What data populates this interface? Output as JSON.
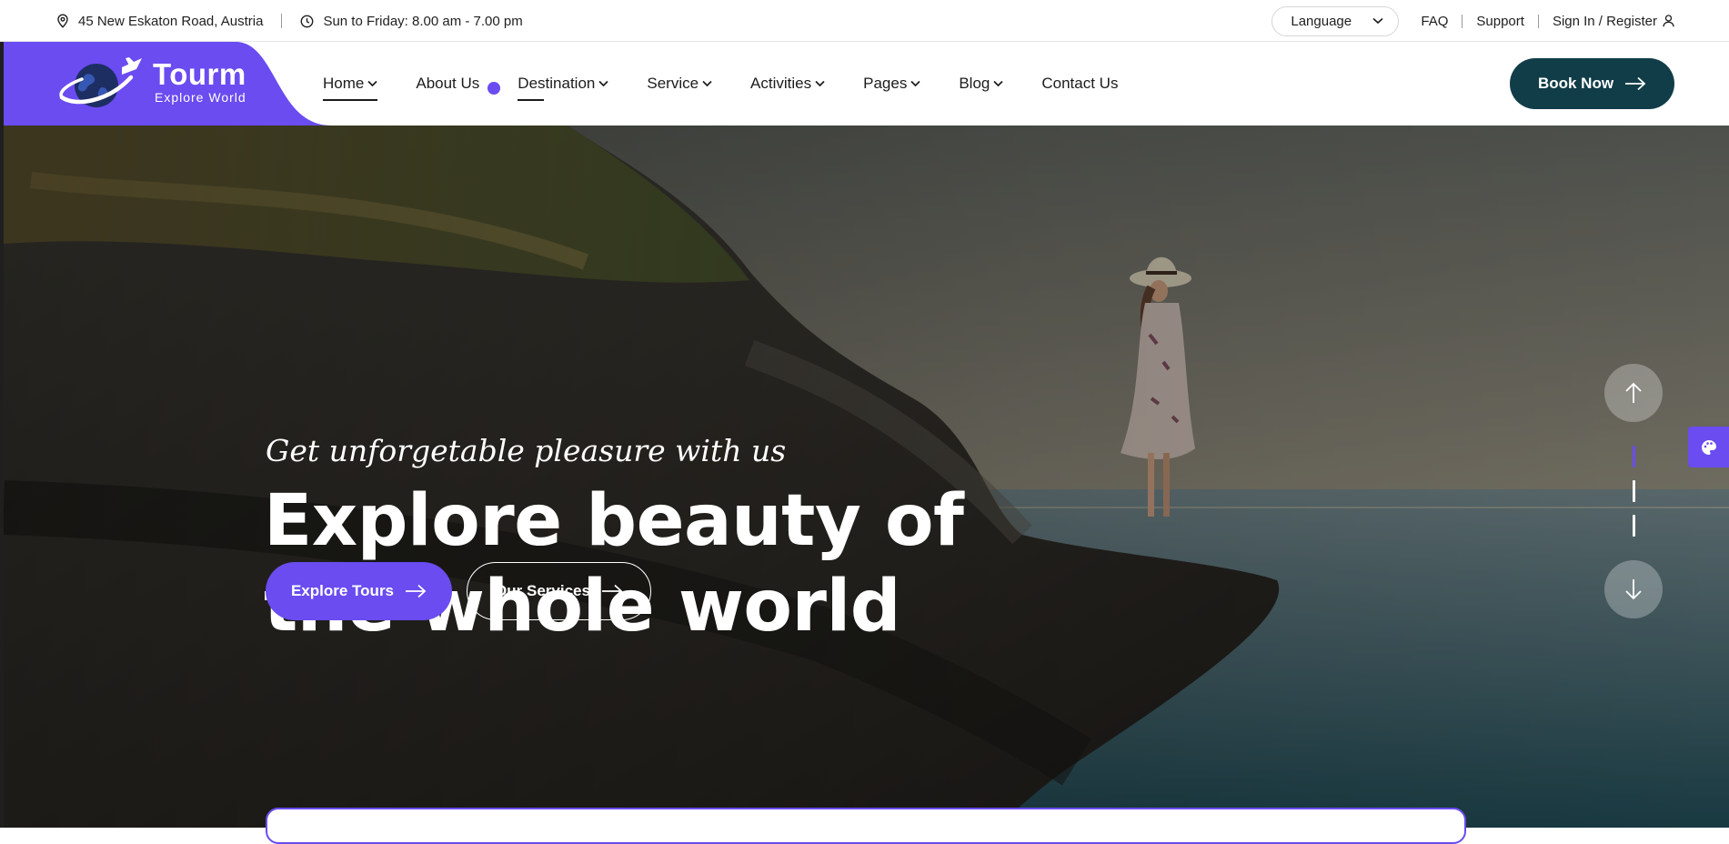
{
  "topbar": {
    "address": "45 New Eskaton Road, Austria",
    "hours": "Sun to Friday: 8.00 am - 7.00 pm",
    "language_label": "Language",
    "links": [
      "FAQ",
      "Support",
      "Sign In / Register"
    ]
  },
  "brand": {
    "name": "Tourm",
    "tagline": "Explore World",
    "accent_color": "#6a4cf0",
    "dark_color": "#113d48"
  },
  "nav": {
    "items": [
      {
        "label": "Home",
        "dropdown": true
      },
      {
        "label": "About Us",
        "dropdown": false
      },
      {
        "label": "Destination",
        "dropdown": true
      },
      {
        "label": "Service",
        "dropdown": true
      },
      {
        "label": "Activities",
        "dropdown": true
      },
      {
        "label": "Pages",
        "dropdown": true
      },
      {
        "label": "Blog",
        "dropdown": true
      },
      {
        "label": "Contact Us",
        "dropdown": false
      }
    ],
    "book_label": "Book Now"
  },
  "hero": {
    "subtitle": "Get unforgetable pleasure with us",
    "title_line1": "Explore beauty of",
    "title_line2": "the whole world",
    "primary_button": "Explore Tours",
    "secondary_button": "Our Services"
  },
  "icons": {
    "address": "map-pin-icon",
    "hours": "clock-icon",
    "language": "chevron-down-icon",
    "signin": "user-icon",
    "book": "arrow-right-icon",
    "slider_prev": "arrow-up-icon",
    "slider_next": "arrow-down-icon",
    "theme": "palette-icon"
  }
}
